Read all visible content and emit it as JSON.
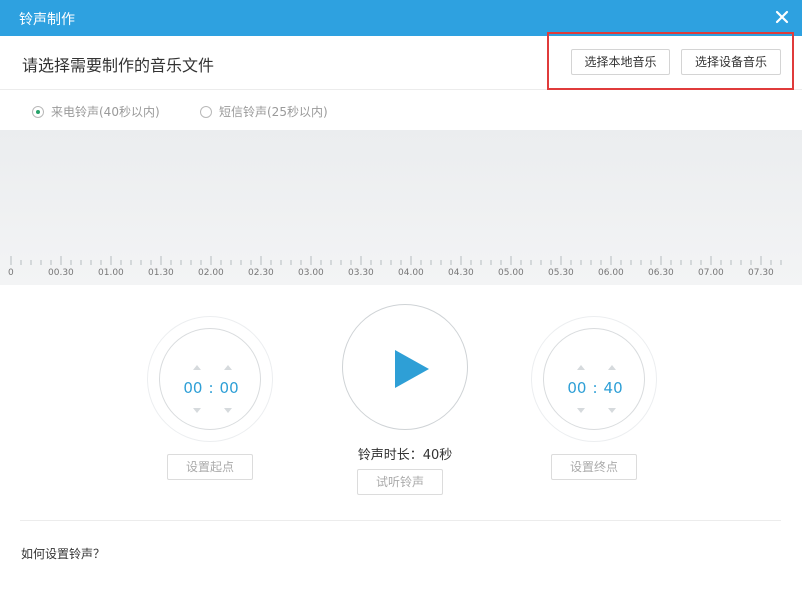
{
  "window": {
    "title": "铃声制作",
    "close_icon": "close-icon"
  },
  "header": {
    "prompt": "请选择需要制作的音乐文件",
    "buttons": {
      "local_music": "选择本地音乐",
      "device_music": "选择设备音乐"
    },
    "highlight_color": "#e03b3b"
  },
  "ringtone_type": {
    "options": [
      {
        "label": "来电铃声(40秒以内)",
        "selected": true
      },
      {
        "label": "短信铃声(25秒以内)",
        "selected": false
      }
    ]
  },
  "timeline": {
    "ticks": [
      "0",
      "00.30",
      "01.00",
      "01.30",
      "02.00",
      "02.30",
      "03.00",
      "03.30",
      "04.00",
      "04.30",
      "05.00",
      "05.30",
      "06.00",
      "06.30",
      "07.00",
      "07.30"
    ]
  },
  "start_dial": {
    "minutes": "00",
    "colon": ":",
    "seconds": "00",
    "button": "设置起点"
  },
  "end_dial": {
    "minutes": "00",
    "colon": ":",
    "seconds": "40",
    "button": "设置终点"
  },
  "player": {
    "play_icon": "play-icon",
    "duration_text": "铃声时长：40秒",
    "preview_button": "试听铃声"
  },
  "footer": {
    "help_link": "如何设置铃声？"
  },
  "colors": {
    "titlebar": "#2ea1e0",
    "accent": "#2e9fd6",
    "radio_selected": "#27a36b"
  }
}
